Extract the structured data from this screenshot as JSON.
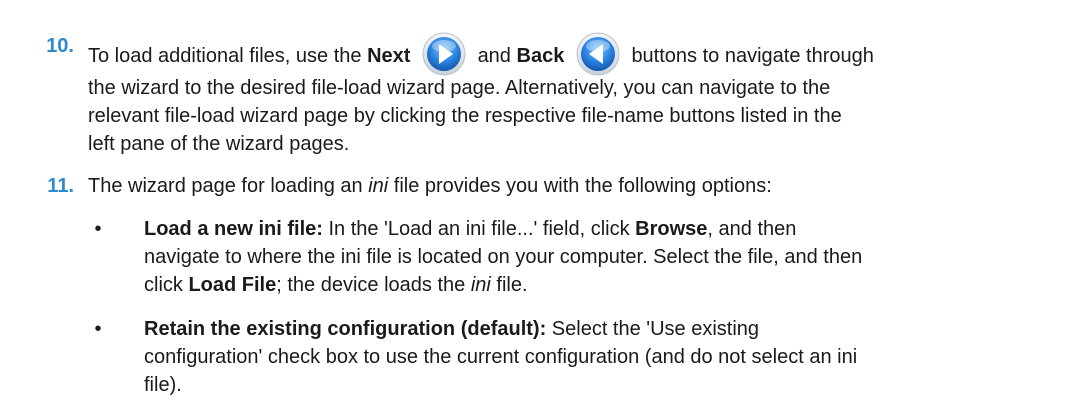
{
  "step10": {
    "number": "10.",
    "l1_a": "To load additional files, use the ",
    "next_label": "Next",
    "l1_b": "and ",
    "back_label": "Back",
    "l1_c": "buttons to navigate through",
    "l2": "the wizard to the desired file-load wizard page. Alternatively, you can navigate to the",
    "l3": "relevant file-load wizard page by clicking the respective file-name buttons listed in the",
    "l4": "left pane of the wizard pages."
  },
  "step11": {
    "number": "11.",
    "l1_a": "The wizard page for loading an ",
    "l1_ini": "ini",
    "l1_b": " file provides you with the following options:"
  },
  "bullets": [
    {
      "dot": "•",
      "title": "Load a new ini file:",
      "l1_a": " In the 'Load an ini file...' field, click ",
      "browse": "Browse",
      "l1_b": ", and then",
      "l2": "navigate to where the ini file is located on your computer. Select the file, and then",
      "l3_a": "click ",
      "load_file": "Load File",
      "l3_b": "; the device loads the ",
      "l3_ini": "ini",
      "l3_c": " file."
    },
    {
      "dot": "•",
      "title": "Retain the existing configuration (default):",
      "l1_a": " Select the 'Use existing",
      "l2": "configuration' check box to use the current configuration (and do not select an ini",
      "l3": "file)."
    }
  ],
  "colors": {
    "step_number": "#2e8bcc",
    "button_blue": "#1f74d6",
    "text": "#1a1a1a"
  },
  "icons": {
    "next": "play-arrow-right-icon",
    "back": "play-arrow-left-icon"
  }
}
